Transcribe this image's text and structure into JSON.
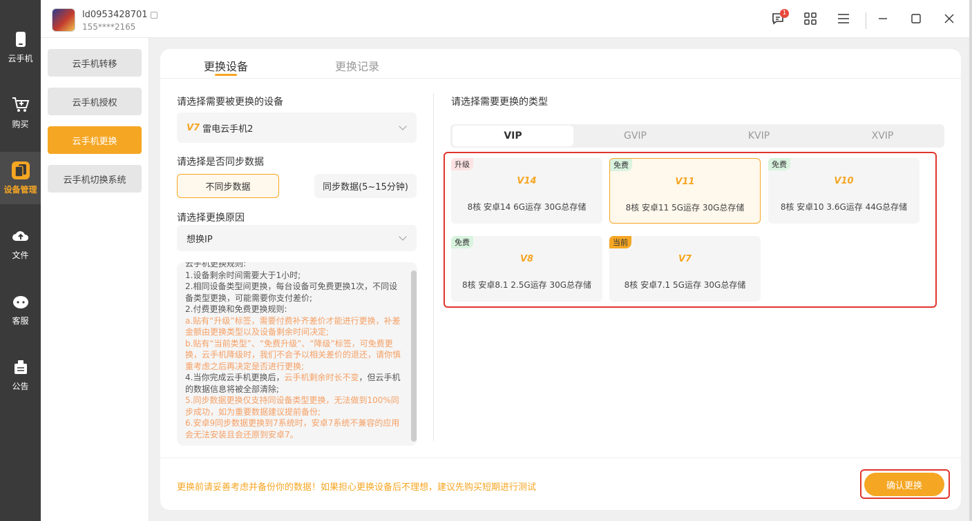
{
  "rail": {
    "items": [
      {
        "label": "云手机",
        "icon": "phone-icon"
      },
      {
        "label": "购买",
        "icon": "cart-icon"
      },
      {
        "label": "设备管理",
        "icon": "device-manage-icon"
      },
      {
        "label": "文件",
        "icon": "cloud-upload-icon"
      },
      {
        "label": "客服",
        "icon": "support-icon"
      },
      {
        "label": "公告",
        "icon": "notice-icon"
      }
    ]
  },
  "user": {
    "id": "ld0953428701",
    "phone": "155****2165"
  },
  "topbar": {
    "message_badge": "1"
  },
  "subnav": {
    "items": [
      "云手机转移",
      "云手机授权",
      "云手机更换",
      "云手机切换系统"
    ]
  },
  "tabs": {
    "replace": "更换设备",
    "records": "更换记录"
  },
  "left": {
    "device_label": "请选择需要被更换的设备",
    "device_tag": "V7",
    "device_value": "雷电云手机2",
    "sync_label": "请选择是否同步数据",
    "sync_no": "不同步数据",
    "sync_yes": "同步数据(5~15分钟)",
    "reason_label": "请选择更换原因",
    "reason_value": "想换IP"
  },
  "rules": {
    "title": "云手机更换规则:",
    "r1": "1.设备剩余时间需要大于1小时;",
    "r2": "2.相同设备类型间更换，每台设备可免费更换1次，不同设备类型更换，可能需要你支付差价;",
    "r3": "2.付费更换和免费更换规则:",
    "r3a": "a.贴有“升级”标签，需要付费补齐差价才能进行更换，补差金额由更换类型以及设备剩余时间决定;",
    "r3b": "b.贴有“当前类型”、“免费升级”、“降级”标签，可免费更换，云手机降级时，我们不会予以相关差价的退还，请你慎重考虑之后再决定是否进行更换;",
    "r4a": "4.当你完成云手机更换后，",
    "r4b": "云手机剩余时长不变",
    "r4c": "，但云手机的数据信息将被全部清除;",
    "r5": "5.同步数据更换仅支持同设备类型更换，无法做到100%同步成功，如为重要数据建议提前备份;",
    "r6": "6.安卓9同步数据更换到7系统时，安卓7系统不兼容的应用会无法安装且会还原到安卓7。"
  },
  "right": {
    "type_label": "请选择需要更换的类型",
    "segments": [
      "VIP",
      "GVIP",
      "KVIP",
      "XVIP"
    ],
    "devices": [
      {
        "tag": "升级",
        "logo": "V14",
        "spec": "8核  安卓14 6G运存 30G总存储"
      },
      {
        "tag": "免费",
        "logo": "V11",
        "spec": "8核  安卓11 5G运存 30G总存储"
      },
      {
        "tag": "免费",
        "logo": "V10",
        "spec": "8核  安卓10 3.6G运存 44G总存储"
      },
      {
        "tag": "免费",
        "logo": "V8",
        "spec": "8核  安卓8.1 2.5G运存 30G总存储"
      },
      {
        "tag": "当前",
        "logo": "V7",
        "spec": "8核  安卓7.1 5G运存 30G总存储"
      }
    ]
  },
  "footer": {
    "note": "更换前请妥善考虑并备份你的数据！如果担心更换设备后不理想，建议先购买短期进行测试",
    "confirm": "确认更换"
  },
  "colors": {
    "accent": "#f5a623",
    "highlight_outline": "#e0352b",
    "rail_bg": "#3a3a3a"
  }
}
